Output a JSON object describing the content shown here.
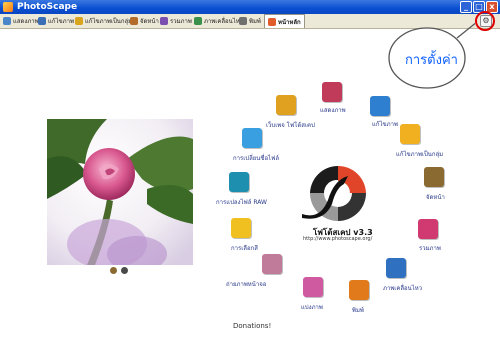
{
  "window": {
    "title": "PhotoScape",
    "controls": [
      "_",
      "□",
      "x"
    ]
  },
  "tabs": [
    {
      "label": "แสดงภาพ",
      "color": "#4a86c8"
    },
    {
      "label": "แก้ไขภาพ",
      "color": "#3a6fb6"
    },
    {
      "label": "แก้ไขภาพเป็นกลุ่ม",
      "color": "#d9a41e"
    },
    {
      "label": "จัดหน้า",
      "color": "#b36b2a"
    },
    {
      "label": "รวมภาพ",
      "color": "#7a4fb0"
    },
    {
      "label": "ภาพเคลื่อนไหว",
      "color": "#3a8f4a"
    },
    {
      "label": "พิมพ์",
      "color": "#6f6f6f"
    },
    {
      "label": "หน้าหลัก",
      "color": "#e25b2a",
      "active": true
    }
  ],
  "annotation": {
    "label": "การตั้งค่า"
  },
  "settings_button": {
    "icon": "settings-icon"
  },
  "menu": [
    {
      "id": "viewer",
      "label": "แสดงภาพ",
      "color": "#c03a5a"
    },
    {
      "id": "editor",
      "label": "แก้ไขภาพ",
      "color": "#2f7fd0"
    },
    {
      "id": "batch-editor",
      "label": "แก้ไขภาพเป็นกลุ่ม",
      "color": "#f0b020"
    },
    {
      "id": "page",
      "label": "จัดหน้า",
      "color": "#8a6a30"
    },
    {
      "id": "combine",
      "label": "รวมภาพ",
      "color": "#d03a70"
    },
    {
      "id": "gif-animation",
      "label": "ภาพเคลื่อนไหว",
      "color": "#3070c0"
    },
    {
      "id": "print",
      "label": "พิมพ์",
      "color": "#e07a1a"
    },
    {
      "id": "splitter",
      "label": "แบ่งภาพ",
      "color": "#d05aa0"
    },
    {
      "id": "screen-capture",
      "label": "ถ่ายภาพหน้าจอ",
      "color": "#c07a9a"
    },
    {
      "id": "color-picker",
      "label": "การเลือกสี",
      "color": "#f0c020"
    },
    {
      "id": "raw-converter",
      "label": "การแปลงไฟล์ RAW",
      "color": "#1f8fb0"
    },
    {
      "id": "rename",
      "label": "การเปลี่ยนชื่อไฟล์",
      "color": "#3a9fe0"
    },
    {
      "id": "photoscape-page",
      "label": "เว็บเพจ โฟโต้สเคป",
      "color": "#e0a020"
    }
  ],
  "logo": {
    "name": "โฟโต้สเคป v3.3",
    "url": "http://www.photoscape.org/"
  },
  "footer": {
    "donations": "Donations!"
  },
  "viewer_controls": [
    {
      "icon": "rotate-icon"
    },
    {
      "icon": "view-icon"
    }
  ]
}
